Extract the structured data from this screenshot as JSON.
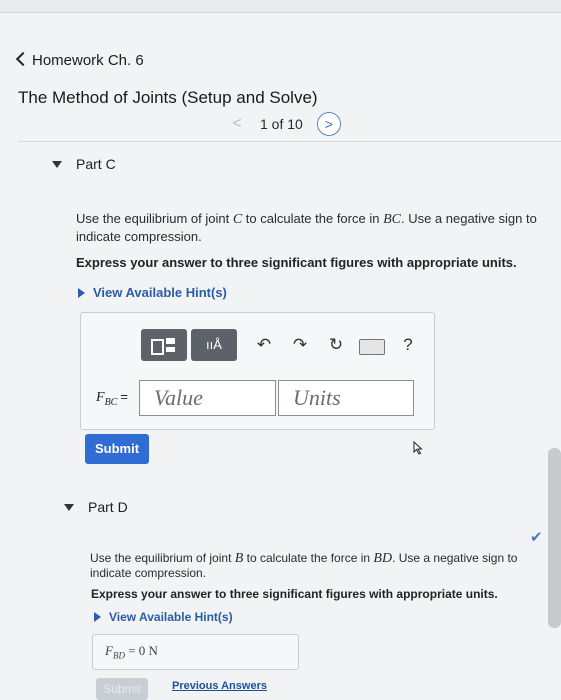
{
  "nav": {
    "back_label": "Homework Ch. 6"
  },
  "title": "The Method of Joints (Setup and Solve)",
  "pager": {
    "prev": "<",
    "count": "1 of 10",
    "next": ">"
  },
  "part_c": {
    "label": "Part C",
    "prompt_1": "Use the equilibrium of joint ",
    "joint": "C",
    "prompt_2": " to calculate the force in ",
    "member": "BC",
    "prompt_3": ". Use a negative sign to indicate compression.",
    "instruction": "Express your answer to three significant figures with appropriate units.",
    "hint_label": "View Available Hint(s)",
    "toolbar": {
      "templates_label": "",
      "units_label": "ııÅ",
      "help_label": "?"
    },
    "variable": "F",
    "variable_sub": "BC",
    "equals": "=",
    "value_placeholder": "Value",
    "units_placeholder": "Units",
    "submit_label": "Submit"
  },
  "part_d": {
    "label": "Part D",
    "prompt_1": "Use the equilibrium of joint ",
    "joint": "B",
    "prompt_2": " to calculate the force in ",
    "member": "BD",
    "prompt_3": ". Use a negative sign to indicate compression.",
    "instruction": "Express your answer to three significant figures with appropriate units.",
    "hint_label": "View Available Hint(s)",
    "variable": "F",
    "variable_sub": "BD",
    "answer": "= 0 N",
    "submit_label": "Submit",
    "previous_answers_label": "Previous Answers"
  },
  "colors": {
    "accent": "#2f6cd4",
    "link": "#2a5ca8",
    "check": "#3b7fc9"
  }
}
